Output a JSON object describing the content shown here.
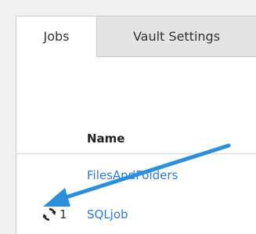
{
  "tabs": [
    {
      "label": "Jobs",
      "active": true
    },
    {
      "label": "Vault Settings",
      "active": false
    }
  ],
  "table": {
    "header": "Name",
    "rows": [
      {
        "name": "FilesAndFolders",
        "status_icon": "",
        "count": ""
      },
      {
        "name": "SQLjob",
        "status_icon": "refresh-icon",
        "count": "1"
      }
    ]
  },
  "annotation": {
    "type": "arrow-icon",
    "color": "#2b8fd9"
  },
  "colors": {
    "link": "#2b7bd6",
    "arrow": "#2b8fd9",
    "tab_border": "#c9c9c9"
  }
}
